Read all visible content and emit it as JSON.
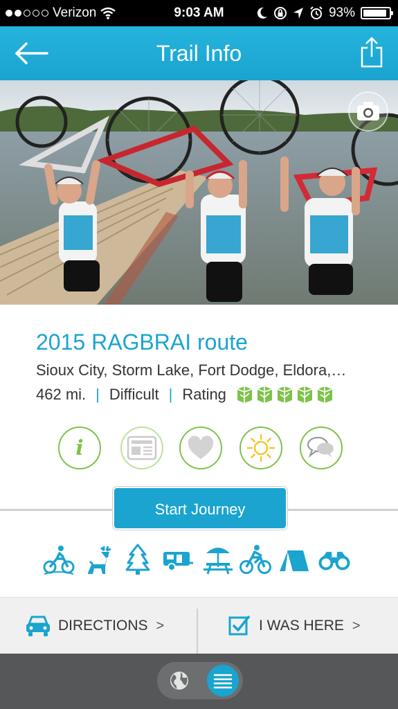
{
  "status_bar": {
    "carrier": "Verizon",
    "time": "9:03 AM",
    "battery": "93%",
    "battery_level": 0.93
  },
  "nav": {
    "title": "Trail Info",
    "back_icon": "arrow-left-icon",
    "share_icon": "share-icon"
  },
  "hero": {
    "camera_icon": "camera-icon"
  },
  "trail": {
    "name": "2015 RAGBRAI route",
    "towns": "Sioux City, Storm Lake, Fort Dodge, Eldora,…",
    "distance": "462 mi.",
    "difficulty": "Difficult",
    "rating_label": "Rating",
    "rating_value": 5,
    "rating_max": 5
  },
  "circle_actions": [
    {
      "icon": "info-icon",
      "glyph": "i"
    },
    {
      "icon": "newspaper-icon"
    },
    {
      "icon": "heart-icon"
    },
    {
      "icon": "sun-icon"
    },
    {
      "icon": "speech-bubbles-icon"
    }
  ],
  "start_journey": {
    "label": "Start Journey"
  },
  "activities": [
    "mountain-bike-icon",
    "deer-icon",
    "tree-icon",
    "camper-icon",
    "picnic-table-icon",
    "road-bike-icon",
    "tent-icon",
    "binoculars-icon"
  ],
  "actions": {
    "directions_label": "DIRECTIONS",
    "was_here_label": "I WAS HERE",
    "chevron": ">"
  },
  "tab_bar": {
    "globe_icon": "globe-icon",
    "list_icon": "list-icon"
  },
  "colors": {
    "accent_blue": "#1aa4cf",
    "accent_green": "#7ec24a",
    "status_bar": "#000000",
    "tab_bar": "#555759"
  }
}
